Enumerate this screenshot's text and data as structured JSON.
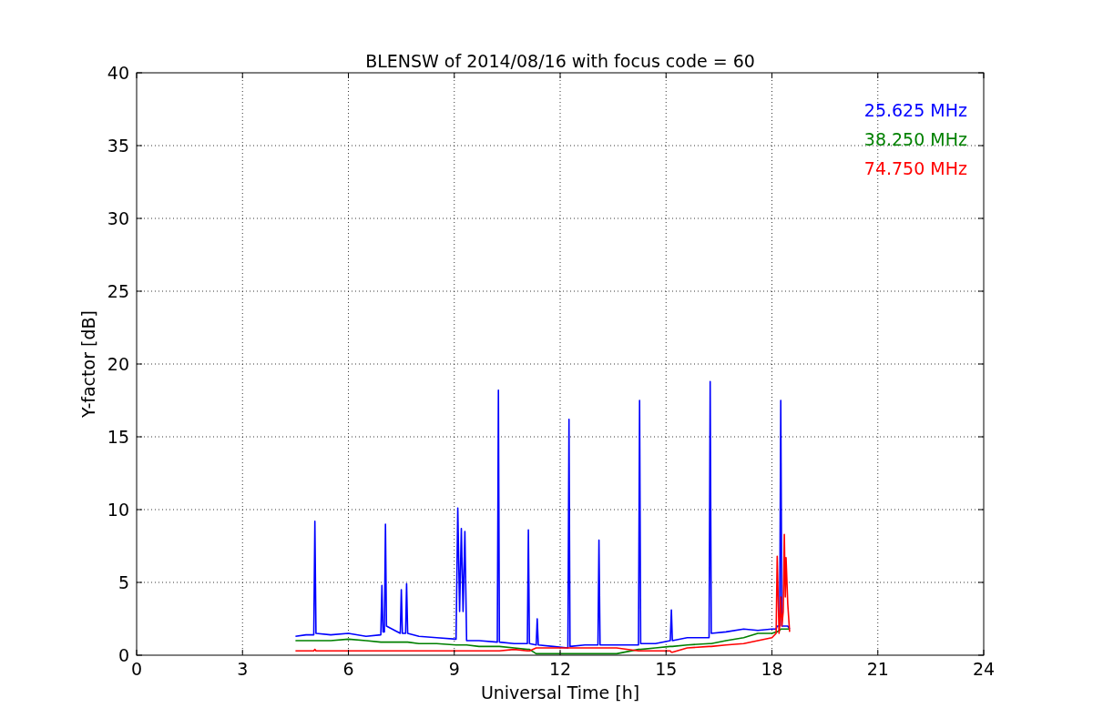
{
  "chart": {
    "chart_data": {
      "type": "line",
      "grid": true,
      "title": "BLENSW of 2014/08/16 with focus code = 60",
      "xlabel": "Universal Time [h]",
      "ylabel": "Y-factor [dB]",
      "xlim": [
        0,
        24
      ],
      "ylim": [
        0,
        40
      ],
      "xticks": [
        0,
        3,
        6,
        9,
        12,
        15,
        18,
        21,
        24
      ],
      "yticks": [
        0,
        5,
        10,
        15,
        20,
        25,
        30,
        35,
        40
      ],
      "x": [
        4.5,
        4.8,
        5.02,
        5.05,
        5.08,
        5.5,
        6.0,
        6.5,
        6.92,
        6.95,
        6.98,
        7.02,
        7.05,
        7.08,
        7.47,
        7.5,
        7.53,
        7.62,
        7.65,
        7.68,
        8.0,
        8.5,
        9.05,
        9.1,
        9.15,
        9.2,
        9.25,
        9.3,
        9.35,
        9.7,
        10.22,
        10.25,
        10.28,
        10.7,
        11.07,
        11.1,
        11.13,
        11.32,
        11.35,
        11.38,
        11.8,
        12.22,
        12.25,
        12.28,
        12.7,
        13.07,
        13.1,
        13.13,
        13.6,
        14.22,
        14.25,
        14.28,
        14.7,
        15.12,
        15.15,
        15.18,
        15.6,
        16.22,
        16.25,
        16.28,
        16.7,
        17.2,
        17.6,
        18.0,
        18.12,
        18.15,
        18.2,
        18.22,
        18.25,
        18.28,
        18.32,
        18.35,
        18.38,
        18.4,
        18.45,
        18.5
      ],
      "series": [
        {
          "name": "25.625 MHz",
          "color": "#0000ff",
          "values": [
            1.3,
            1.4,
            1.4,
            9.2,
            1.5,
            1.4,
            1.5,
            1.3,
            1.4,
            4.8,
            1.6,
            1.6,
            9.0,
            2.0,
            1.5,
            4.5,
            1.5,
            1.5,
            4.9,
            1.5,
            1.3,
            1.2,
            1.1,
            10.1,
            3.0,
            8.7,
            3.0,
            8.5,
            1.0,
            1.0,
            0.9,
            18.2,
            0.9,
            0.8,
            0.8,
            8.6,
            0.8,
            0.7,
            2.5,
            0.7,
            0.6,
            0.5,
            16.2,
            0.6,
            0.7,
            0.7,
            7.9,
            0.7,
            0.7,
            0.7,
            17.5,
            0.8,
            0.8,
            1.0,
            3.1,
            1.0,
            1.2,
            1.2,
            18.8,
            1.5,
            1.6,
            1.8,
            1.7,
            1.8,
            1.8,
            2.0,
            2.0,
            2.0,
            17.5,
            2.0,
            2.0,
            2.0,
            2.0,
            2.0,
            2.0,
            1.8
          ]
        },
        {
          "name": "38.250 MHz",
          "color": "#008000",
          "values": [
            1.0,
            1.0,
            1.0,
            1.0,
            1.0,
            1.0,
            1.1,
            1.0,
            0.9,
            0.9,
            0.9,
            0.9,
            0.9,
            0.9,
            0.9,
            0.9,
            0.9,
            0.9,
            0.9,
            0.9,
            0.8,
            0.8,
            0.7,
            0.7,
            0.7,
            0.7,
            0.7,
            0.7,
            0.7,
            0.6,
            0.6,
            0.6,
            0.6,
            0.5,
            0.4,
            0.4,
            0.4,
            0.1,
            0.1,
            0.1,
            0.1,
            0.1,
            0.1,
            0.1,
            0.1,
            0.1,
            0.1,
            0.1,
            0.1,
            0.4,
            0.4,
            0.4,
            0.5,
            0.6,
            0.6,
            0.6,
            0.7,
            0.8,
            0.8,
            0.8,
            1.0,
            1.2,
            1.5,
            1.5,
            1.6,
            1.6,
            1.7,
            1.7,
            1.8,
            1.8,
            1.8,
            1.8,
            1.8,
            1.8,
            1.8,
            1.8
          ]
        },
        {
          "name": "74.750 MHz",
          "color": "#ff0000",
          "values": [
            0.3,
            0.3,
            0.3,
            0.4,
            0.3,
            0.3,
            0.3,
            0.3,
            0.3,
            0.3,
            0.3,
            0.3,
            0.3,
            0.3,
            0.3,
            0.3,
            0.3,
            0.3,
            0.3,
            0.3,
            0.3,
            0.3,
            0.3,
            0.3,
            0.3,
            0.3,
            0.3,
            0.3,
            0.3,
            0.3,
            0.3,
            0.3,
            0.3,
            0.4,
            0.3,
            0.3,
            0.3,
            0.5,
            0.5,
            0.5,
            0.5,
            0.5,
            0.5,
            0.5,
            0.5,
            0.5,
            0.5,
            0.5,
            0.5,
            0.3,
            0.3,
            0.3,
            0.3,
            0.3,
            0.2,
            0.2,
            0.5,
            0.6,
            0.6,
            0.6,
            0.7,
            0.8,
            1.0,
            1.2,
            1.5,
            6.8,
            1.5,
            2.0,
            4.0,
            2.0,
            3.0,
            8.3,
            4.0,
            6.7,
            3.5,
            1.6
          ]
        }
      ]
    }
  }
}
